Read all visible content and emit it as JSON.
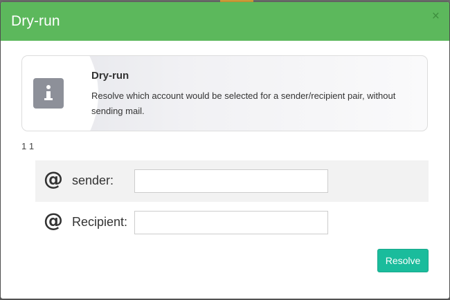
{
  "modal": {
    "title": "Dry-run",
    "close_label": "×"
  },
  "info": {
    "icon": "info-icon",
    "title": "Dry-run",
    "text": "Resolve which account would be selected for a sender/recipient pair, without sending mail."
  },
  "counter": {
    "text": "1 1"
  },
  "form": {
    "sender": {
      "icon": "at-icon",
      "icon_glyph": "@",
      "label": "sender:",
      "value": "",
      "placeholder": ""
    },
    "recipient": {
      "icon": "at-icon",
      "icon_glyph": "@",
      "label": "Recipient:",
      "value": "",
      "placeholder": ""
    }
  },
  "actions": {
    "resolve_label": "Resolve"
  },
  "colors": {
    "header_green": "#5cb85c",
    "button_teal": "#1abc9c",
    "icon_grey": "#8d9099"
  }
}
